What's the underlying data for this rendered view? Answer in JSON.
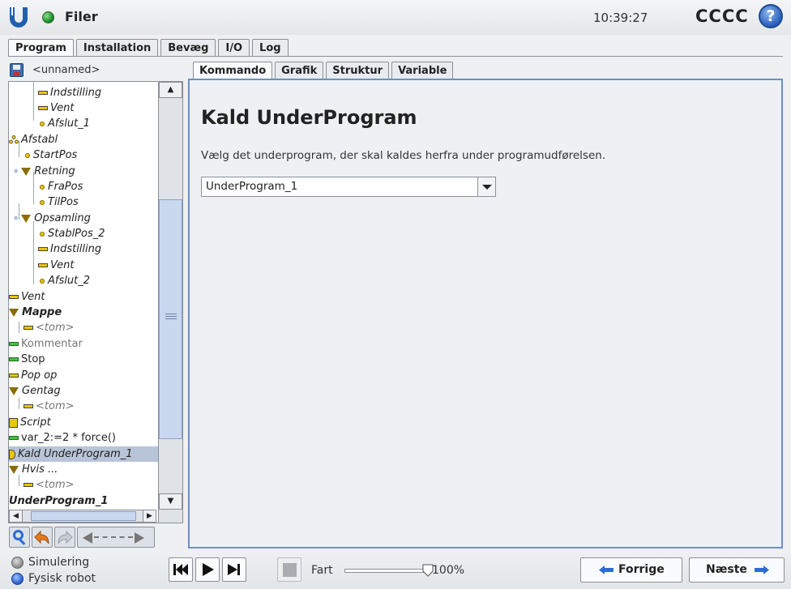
{
  "topbar": {
    "title": "Filer",
    "time": "10:39:27",
    "robot_name": "CCCC",
    "help_label": "?"
  },
  "main_tabs": [
    {
      "label": "Program",
      "active": true
    },
    {
      "label": "Installation",
      "active": false
    },
    {
      "label": "Bevæg",
      "active": false
    },
    {
      "label": "I/O",
      "active": false
    },
    {
      "label": "Log",
      "active": false
    }
  ],
  "program": {
    "file_name": "<unnamed>"
  },
  "tree": [
    {
      "label": "Indstilling",
      "icon": "set-icon"
    },
    {
      "label": "Vent",
      "icon": "wait-icon"
    },
    {
      "label": "Afslut_1",
      "icon": "waypoint-icon"
    },
    {
      "label": "Afstabl",
      "icon": "stack-icon"
    },
    {
      "label": "StartPos",
      "icon": "waypoint-icon"
    },
    {
      "label": "Retning",
      "icon": "folder-icon"
    },
    {
      "label": "FraPos",
      "icon": "waypoint-icon"
    },
    {
      "label": "TilPos",
      "icon": "waypoint-icon"
    },
    {
      "label": "Opsamling",
      "icon": "folder-icon"
    },
    {
      "label": "StablPos_2",
      "icon": "waypoint-icon"
    },
    {
      "label": "Indstilling",
      "icon": "set-icon"
    },
    {
      "label": "Vent",
      "icon": "wait-icon"
    },
    {
      "label": "Afslut_2",
      "icon": "waypoint-icon"
    },
    {
      "label": "Vent",
      "icon": "wait-icon"
    },
    {
      "label": "Mappe",
      "icon": "folder-icon"
    },
    {
      "label": "<tom>",
      "icon": "empty-icon"
    },
    {
      "label": "Kommentar",
      "icon": "comment-icon"
    },
    {
      "label": "Stop",
      "icon": "stop-icon"
    },
    {
      "label": "Pop op",
      "icon": "popup-icon"
    },
    {
      "label": "Gentag",
      "icon": "loop-icon"
    },
    {
      "label": "<tom>",
      "icon": "empty-icon"
    },
    {
      "label": "Script",
      "icon": "script-icon"
    },
    {
      "label": "var_2:=2 * force()",
      "icon": "assignment-icon"
    },
    {
      "label": "Kald UnderProgram_1",
      "icon": "call-icon",
      "selected": true
    },
    {
      "label": "Hvis ...",
      "icon": "if-icon"
    },
    {
      "label": "<tom>",
      "icon": "empty-icon"
    },
    {
      "label": "UnderProgram_1",
      "icon": "subprogram-icon"
    }
  ],
  "sub_tabs": [
    {
      "label": "Kommando",
      "active": true
    },
    {
      "label": "Grafik",
      "active": false
    },
    {
      "label": "Struktur",
      "active": false
    },
    {
      "label": "Variable",
      "active": false
    }
  ],
  "command": {
    "heading": "Kald UnderProgram",
    "description": "Vælg det underprogram, der skal kaldes herfra under programudførelsen.",
    "selected_subprogram": "UnderProgram_1"
  },
  "bottom": {
    "mode_simulation": "Simulering",
    "mode_real": "Fysisk robot",
    "speed_label": "Fart",
    "speed_value": "100%",
    "speed_fraction": 1.0,
    "prev_label": "Forrige",
    "next_label": "Næste"
  },
  "colors": {
    "accent_border": "#6d8fc9",
    "icon_yellow": "#e8c800",
    "icon_green": "#3cc43c"
  }
}
